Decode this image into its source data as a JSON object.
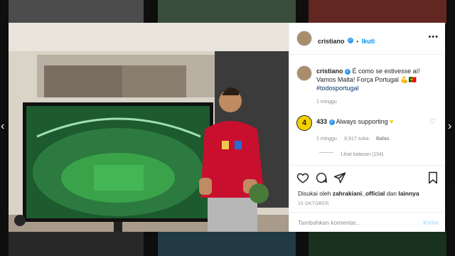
{
  "post": {
    "username": "cristiano",
    "follow_label": "Ikuti",
    "caption_username": "cristiano",
    "caption_line1": "É como se estivesse aí!",
    "caption_line2": "Vamos Malta! Força Portugal 💪🇵🇹",
    "caption_line3": "#todosportugal",
    "caption_time": "1 minggu"
  },
  "comment": {
    "username": "433",
    "text": "Always supporting",
    "time": "1 minggu",
    "likes": "8,917 suka",
    "reply_label": "Balas",
    "view_replies": "Lihat balasan (154)"
  },
  "liked_by": {
    "prefix": "Disukai oleh",
    "user": "zahrakiani_official",
    "mid": "dan",
    "rest": "lainnya"
  },
  "date": "15 OKTOBER",
  "comment_input": {
    "placeholder": "Tambahkan komentar..."
  },
  "post_button": "Kirim",
  "icons": [
    "heart-icon",
    "comment-icon",
    "share-icon",
    "bookmark-icon",
    "more-icon",
    "verified-icon",
    "emoji-heart-icon",
    "left-arrow-icon",
    "right-arrow-icon"
  ],
  "colors": {
    "accent": "#0095f6",
    "verified": "#3897f0",
    "jersey": "#c8102e",
    "pitch": "#3aa34a"
  }
}
